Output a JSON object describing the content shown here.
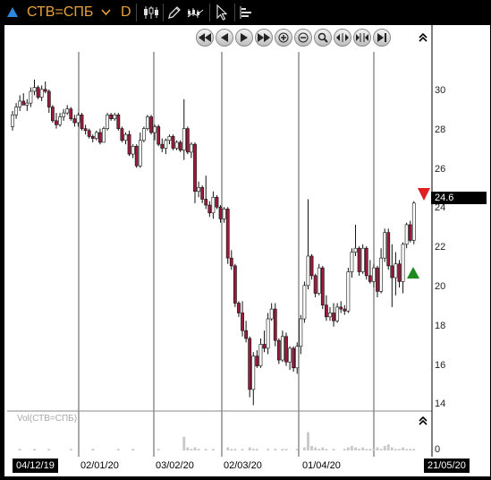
{
  "toolbar": {
    "ric": "СТВ=СПБ",
    "interval": "D",
    "icons": [
      "ric-status-arrow-icon",
      "dropdown-chevron-icon",
      "candlestick-icon",
      "draw-pencil-icon",
      "chart-type-icon",
      "pointer-icon",
      "volume-profile-icon"
    ]
  },
  "navigation": {
    "buttons": [
      "rewind-icon",
      "scroll-left-icon",
      "scroll-right-icon",
      "fast-forward-icon",
      "zoom-in-icon",
      "zoom-out-icon",
      "zoom-box-icon",
      "expand-horizontal-icon",
      "fit-horizontal-icon",
      "jump-end-icon"
    ]
  },
  "price_badge": "24.6",
  "volume_label": "Vol(СТВ=СПБ)",
  "volume_axis_label": "0",
  "y_ticks": [
    "30",
    "28",
    "26",
    "24",
    "22",
    "20",
    "18",
    "16",
    "14"
  ],
  "x_ticks": [
    "04/12/19",
    "02/01/20",
    "03/02/20",
    "02/03/20",
    "01/04/20",
    "21/05/20"
  ],
  "colors": {
    "up": "#ffffff",
    "down": "#9b1b3d",
    "outline": "#111111",
    "grid": "#555555",
    "down_marker": "#e02020",
    "up_marker": "#1f8a1f"
  },
  "chart_data": {
    "type": "candlestick",
    "ylim": [
      13.5,
      31.5
    ],
    "x_range": [
      "04/12/19",
      "21/05/20"
    ],
    "last_price": 24.6,
    "candles": [
      [
        28.2,
        28.0,
        29.0,
        28.8
      ],
      [
        28.8,
        28.6,
        29.4,
        29.2
      ],
      [
        29.2,
        29.0,
        29.8,
        29.5
      ],
      [
        29.5,
        29.3,
        29.9,
        29.3
      ],
      [
        29.3,
        29.0,
        29.6,
        29.4
      ],
      [
        29.4,
        29.2,
        30.2,
        30.0
      ],
      [
        30.0,
        29.8,
        30.6,
        30.2
      ],
      [
        30.2,
        29.6,
        30.3,
        29.7
      ],
      [
        29.7,
        29.5,
        30.3,
        30.1
      ],
      [
        30.1,
        29.9,
        30.5,
        30.0
      ],
      [
        30.0,
        28.9,
        30.1,
        29.2
      ],
      [
        29.2,
        28.4,
        29.3,
        28.5
      ],
      [
        28.5,
        28.1,
        28.9,
        28.3
      ],
      [
        28.3,
        28.2,
        28.9,
        28.7
      ],
      [
        28.7,
        28.5,
        29.1,
        28.9
      ],
      [
        28.9,
        28.8,
        29.3,
        29.1
      ],
      [
        29.1,
        28.5,
        29.2,
        28.6
      ],
      [
        28.6,
        28.2,
        28.8,
        28.4
      ],
      [
        28.4,
        28.2,
        28.9,
        28.8
      ],
      [
        28.8,
        28.0,
        28.9,
        28.1
      ],
      [
        28.1,
        27.8,
        28.3,
        28.0
      ],
      [
        28.0,
        27.6,
        28.1,
        27.7
      ],
      [
        27.7,
        27.4,
        27.8,
        27.6
      ],
      [
        27.6,
        27.5,
        28.0,
        27.9
      ],
      [
        27.9,
        27.3,
        28.1,
        27.4
      ],
      [
        27.4,
        27.4,
        28.2,
        28.1
      ],
      [
        28.1,
        28.0,
        28.9,
        28.8
      ],
      [
        28.8,
        28.5,
        28.9,
        28.6
      ],
      [
        28.6,
        28.5,
        28.9,
        28.8
      ],
      [
        28.8,
        28.0,
        28.9,
        28.1
      ],
      [
        28.1,
        27.4,
        28.2,
        27.5
      ],
      [
        27.5,
        27.3,
        27.9,
        27.8
      ],
      [
        27.8,
        26.7,
        28.0,
        26.8
      ],
      [
        26.8,
        26.6,
        27.3,
        27.2
      ],
      [
        27.2,
        26.1,
        27.3,
        26.2
      ],
      [
        26.2,
        26.1,
        27.9,
        27.5
      ],
      [
        27.5,
        27.4,
        28.2,
        28.1
      ],
      [
        28.1,
        28.0,
        28.8,
        28.7
      ],
      [
        28.7,
        27.8,
        28.8,
        27.9
      ],
      [
        27.9,
        27.5,
        28.3,
        28.2
      ],
      [
        28.2,
        27.2,
        28.3,
        27.3
      ],
      [
        27.3,
        26.9,
        27.6,
        27.1
      ],
      [
        27.1,
        26.8,
        27.6,
        27.5
      ],
      [
        27.5,
        27.3,
        27.8,
        27.7
      ],
      [
        27.7,
        27.0,
        27.8,
        27.1
      ],
      [
        27.1,
        27.0,
        27.5,
        27.4
      ],
      [
        27.4,
        26.9,
        27.5,
        27.0
      ],
      [
        27.0,
        26.5,
        29.6,
        28.1
      ],
      [
        28.1,
        26.8,
        28.2,
        26.9
      ],
      [
        26.9,
        26.6,
        27.4,
        27.3
      ],
      [
        27.3,
        24.3,
        27.4,
        24.9
      ],
      [
        24.9,
        24.6,
        25.4,
        25.1
      ],
      [
        25.1,
        24.3,
        25.2,
        24.5
      ],
      [
        24.5,
        24.0,
        25.7,
        24.2
      ],
      [
        24.2,
        23.6,
        24.4,
        23.8
      ],
      [
        23.8,
        23.5,
        24.9,
        24.6
      ],
      [
        24.6,
        24.0,
        24.7,
        24.1
      ],
      [
        24.1,
        23.3,
        24.2,
        23.5
      ],
      [
        23.5,
        23.3,
        24.1,
        24.0
      ],
      [
        24.0,
        21.2,
        24.1,
        21.5
      ],
      [
        21.5,
        20.9,
        21.9,
        21.1
      ],
      [
        21.1,
        19.0,
        21.2,
        19.2
      ],
      [
        19.2,
        18.5,
        19.3,
        18.7
      ],
      [
        18.7,
        17.5,
        19.3,
        17.8
      ],
      [
        17.8,
        17.2,
        18.3,
        17.4
      ],
      [
        17.4,
        14.4,
        17.5,
        14.8
      ],
      [
        14.8,
        14.0,
        16.7,
        16.5
      ],
      [
        16.5,
        15.9,
        16.8,
        16.0
      ],
      [
        16.0,
        15.9,
        17.4,
        17.1
      ],
      [
        17.1,
        16.7,
        17.8,
        16.9
      ],
      [
        16.9,
        16.6,
        18.7,
        18.4
      ],
      [
        18.4,
        18.3,
        19.2,
        18.9
      ],
      [
        18.9,
        17.0,
        19.2,
        17.3
      ],
      [
        17.3,
        16.1,
        17.4,
        16.3
      ],
      [
        16.3,
        16.2,
        17.8,
        17.5
      ],
      [
        17.5,
        16.0,
        17.7,
        16.2
      ],
      [
        16.2,
        15.8,
        17.0,
        16.9
      ],
      [
        16.9,
        15.7,
        17.0,
        15.9
      ],
      [
        15.9,
        15.6,
        17.2,
        17.0
      ],
      [
        17.0,
        16.6,
        18.6,
        18.4
      ],
      [
        18.4,
        18.2,
        20.3,
        20.1
      ],
      [
        20.1,
        19.9,
        24.5,
        21.6
      ],
      [
        21.6,
        20.4,
        21.7,
        20.6
      ],
      [
        20.6,
        19.5,
        20.7,
        19.7
      ],
      [
        19.7,
        19.6,
        21.2,
        21.0
      ],
      [
        21.0,
        18.9,
        21.1,
        19.1
      ],
      [
        19.1,
        18.3,
        19.6,
        18.5
      ],
      [
        18.5,
        18.3,
        19.0,
        18.7
      ],
      [
        18.7,
        18.0,
        19.2,
        18.3
      ],
      [
        18.3,
        18.2,
        19.2,
        19.0
      ],
      [
        19.0,
        18.7,
        19.3,
        18.9
      ],
      [
        18.9,
        18.6,
        19.1,
        18.8
      ],
      [
        18.8,
        18.7,
        21.0,
        20.8
      ],
      [
        20.8,
        20.5,
        22.0,
        21.8
      ],
      [
        21.8,
        21.6,
        23.2,
        22.0
      ],
      [
        22.0,
        20.6,
        22.1,
        20.8
      ],
      [
        20.8,
        20.7,
        22.2,
        22.0
      ],
      [
        22.0,
        20.4,
        22.1,
        20.6
      ],
      [
        20.6,
        20.2,
        21.4,
        20.3
      ],
      [
        20.3,
        20.0,
        21.2,
        21.0
      ],
      [
        21.0,
        19.5,
        21.1,
        19.8
      ],
      [
        19.8,
        19.7,
        22.0,
        21.5
      ],
      [
        21.5,
        21.3,
        23.0,
        22.8
      ],
      [
        22.8,
        20.9,
        23.0,
        21.1
      ],
      [
        21.1,
        19.0,
        22.2,
        20.5
      ],
      [
        20.5,
        19.6,
        21.8,
        21.2
      ],
      [
        21.2,
        20.0,
        21.4,
        20.3
      ],
      [
        20.3,
        19.7,
        22.3,
        22.2
      ],
      [
        22.2,
        22.0,
        23.3,
        23.2
      ],
      [
        23.2,
        22.3,
        23.4,
        22.4
      ],
      [
        22.4,
        22.2,
        24.4,
        24.3
      ]
    ],
    "volume": [
      0,
      0,
      1,
      0,
      0,
      0,
      1,
      0,
      0,
      0,
      1,
      0,
      0,
      0,
      0,
      0,
      1,
      0,
      0,
      0,
      0,
      0,
      1,
      0,
      0,
      0,
      0,
      0,
      0,
      1,
      0,
      0,
      0,
      1,
      0,
      0,
      0,
      0,
      0,
      0,
      1,
      0,
      0,
      0,
      0,
      0,
      0,
      9,
      2,
      1,
      2,
      1,
      0,
      1,
      0,
      1,
      0,
      0,
      0,
      2,
      1,
      1,
      0,
      1,
      0,
      2,
      1,
      1,
      0,
      0,
      1,
      0,
      1,
      0,
      1,
      1,
      0,
      0,
      1,
      0,
      2,
      12,
      3,
      2,
      1,
      2,
      1,
      0,
      1,
      0,
      0,
      1,
      2,
      3,
      2,
      1,
      2,
      1,
      1,
      1,
      2,
      1,
      3,
      4,
      2,
      1,
      1,
      2,
      1,
      1,
      1
    ]
  }
}
